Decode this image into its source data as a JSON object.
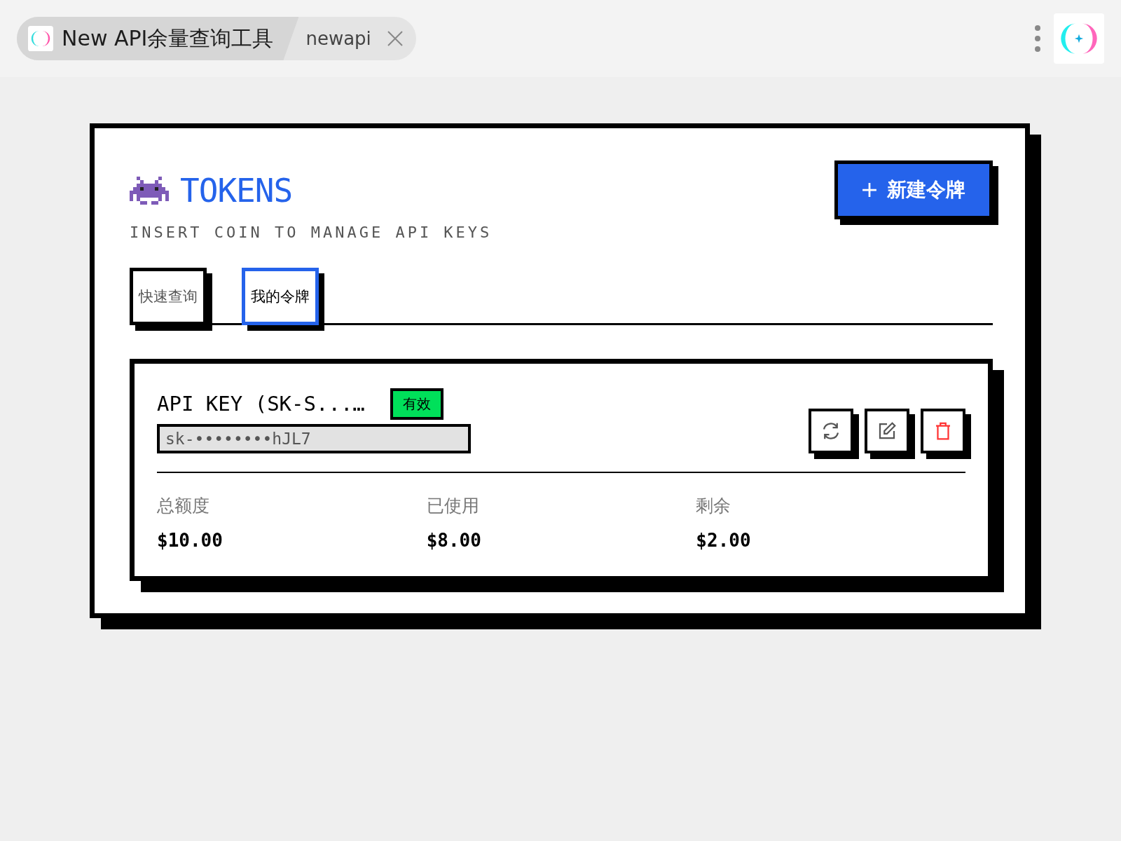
{
  "browser_tabs": [
    {
      "title": "New API余量查询工具",
      "selected": true
    },
    {
      "title": "newapi",
      "selected": false
    }
  ],
  "header": {
    "title": "TOKENS",
    "subtitle": "INSERT COIN TO MANAGE API KEYS",
    "new_button": "新建令牌"
  },
  "tabs": [
    {
      "label": "快速查询",
      "selected": false
    },
    {
      "label": "我的令牌",
      "selected": true
    }
  ],
  "token": {
    "name": "API KEY (SK-S...…",
    "status": {
      "label": "有效",
      "active": true
    },
    "key": "sk-••••••••hJL7",
    "actions": [
      {
        "kind": "refresh"
      },
      {
        "kind": "edit"
      },
      {
        "kind": "delete"
      }
    ],
    "stats": [
      {
        "label": "总额度",
        "value": "$10.00"
      },
      {
        "label": "已使用",
        "value": "$8.00"
      },
      {
        "label": "剩余",
        "value": "$2.00"
      }
    ]
  }
}
